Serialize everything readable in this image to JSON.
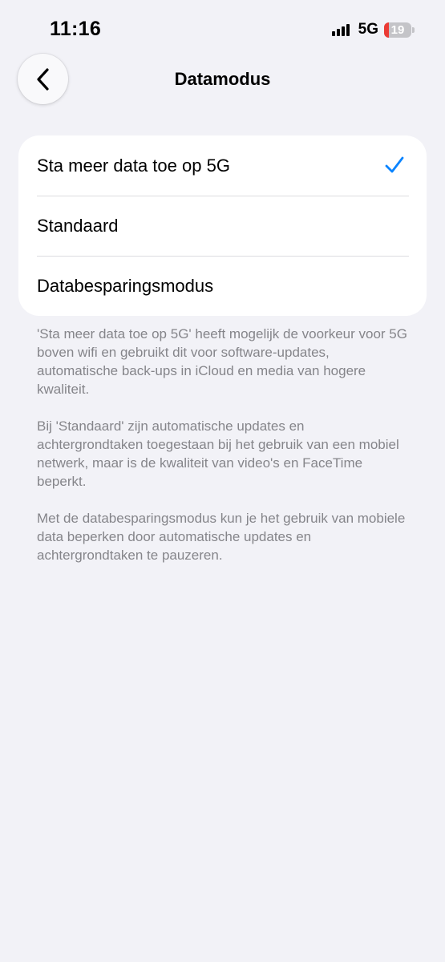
{
  "status_bar": {
    "time": "11:16",
    "network": "5G",
    "battery_level": "19",
    "battery_fraction": 0.19,
    "signal_bars": 4
  },
  "nav": {
    "title": "Datamodus",
    "back_icon": "chevron-left-icon"
  },
  "options": [
    {
      "label": "Sta meer data toe op 5G",
      "selected": true
    },
    {
      "label": "Standaard",
      "selected": false
    },
    {
      "label": "Databesparingsmodus",
      "selected": false
    }
  ],
  "footer": {
    "paragraphs": [
      "'Sta meer data toe op 5G' heeft mogelijk de voorkeur voor 5G boven wifi en gebruikt dit voor software-updates, automatische back-ups in iCloud en media van hogere kwaliteit.",
      "Bij 'Standaard' zijn automatische updates en achtergrondtaken toegestaan bij het gebruik van een mobiel netwerk, maar is de kwaliteit van video's en FaceTime beperkt.",
      "Met de databesparingsmodus kun je het gebruik van mobiele data beperken door automatische updates en achtergrondtaken te pauzeren."
    ]
  },
  "colors": {
    "background": "#f2f2f7",
    "accent": "#0a84ff",
    "battery_low": "#eb3b35",
    "footer_text": "#85858a"
  }
}
